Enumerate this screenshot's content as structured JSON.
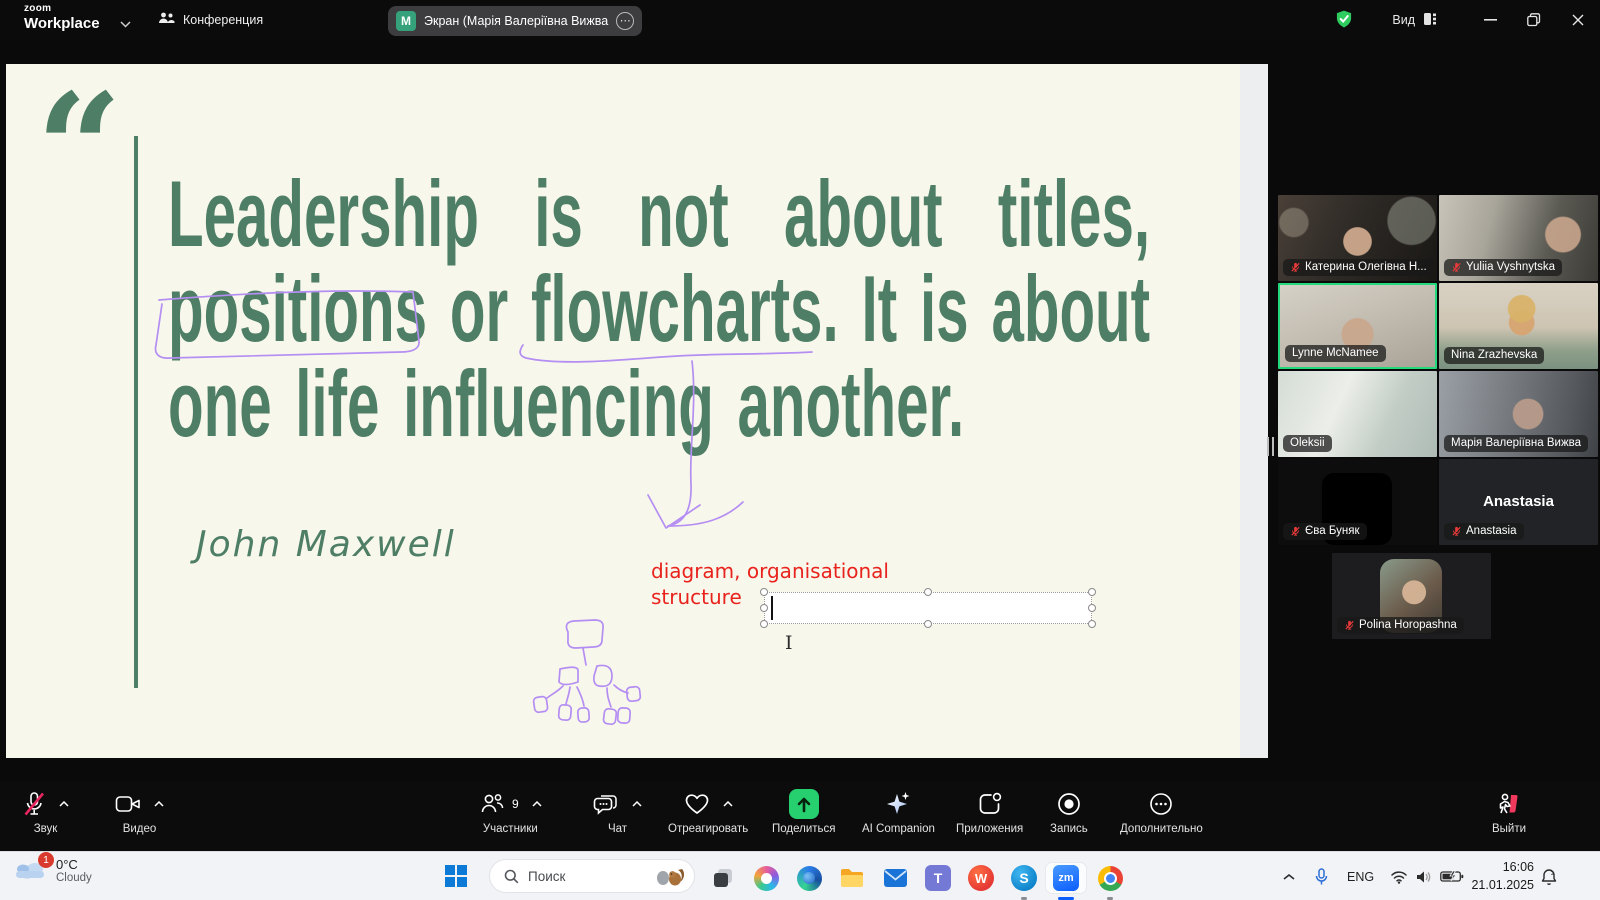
{
  "titlebar": {
    "brand_line1": "zoom",
    "brand_line2": "Workplace",
    "meeting_tab_label": "Конференция",
    "screen_tab_label": "Экран (Марія Валеріївна Вижва",
    "screen_tab_avatar": "M",
    "view_label": "Вид"
  },
  "slide": {
    "quote_line1_words": [
      "Leadership",
      "is",
      "not",
      "about",
      "titles,"
    ],
    "quote_line2_words": [
      "positions",
      "or",
      "flowcharts.",
      "It",
      "is",
      "about"
    ],
    "quote_line3": "one life influencing another.",
    "author": "John Maxwell",
    "annotation_line1": "diagram, organisational",
    "annotation_line2": "structure"
  },
  "participants": [
    {
      "name": "Катерина Олегівна Н...",
      "muted": true
    },
    {
      "name": "Yuliia Vyshnytska",
      "muted": true
    },
    {
      "name": "Lynne McNamee",
      "muted": false,
      "active_speaker": true
    },
    {
      "name": "Nina Zrazhevska",
      "muted": false
    },
    {
      "name": "Oleksii",
      "muted": false
    },
    {
      "name": "Марія Валеріївна Вижва",
      "muted": false
    },
    {
      "name": "Єва Буняк",
      "muted": true
    },
    {
      "name": "Anastasia",
      "muted": true
    },
    {
      "name": "Polina Horopashna",
      "muted": true
    }
  ],
  "toolbar": {
    "audio": "Звук",
    "video": "Видео",
    "participants": "Участники",
    "participants_count": "9",
    "chat": "Чат",
    "react": "Отреагировать",
    "share": "Поделиться",
    "ai": "AI Companion",
    "apps": "Приложения",
    "record": "Запись",
    "more": "Дополнительно",
    "leave": "Выйти"
  },
  "taskbar": {
    "weather_badge": "1",
    "weather_temp": "0°C",
    "weather_desc": "Cloudy",
    "search_placeholder": "Поиск",
    "tray_lang": "ENG",
    "tray_time": "16:06",
    "tray_date": "21.01.2025"
  },
  "colors": {
    "quote_green": "#4e7e65",
    "annotation_purple": "#b48ef2",
    "annotation_red": "#e8231d",
    "share_green": "#27d06e",
    "shield_green": "#2ecc5f",
    "active_border_green": "#24d97b",
    "zoom_blue": "#0b5cff"
  }
}
